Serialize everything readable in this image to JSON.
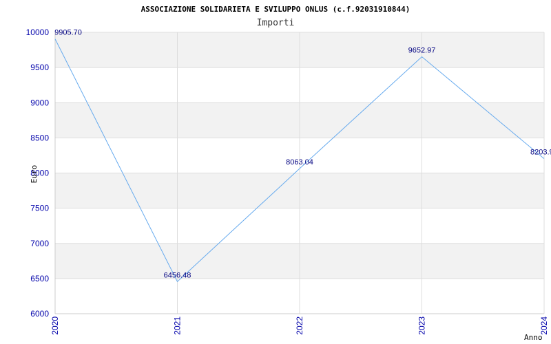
{
  "chart_data": {
    "type": "line",
    "title": "ASSOCIAZIONE SOLIDARIETA E SVILUPPO ONLUS (c.f.92031910844)",
    "subtitle": "Importi",
    "xlabel": "Anno",
    "ylabel": "Euro",
    "categories": [
      "2020",
      "2021",
      "2022",
      "2023",
      "2024"
    ],
    "series": [
      {
        "values": [
          9905.7,
          6456.48,
          8063.04,
          9652.97,
          8203.9
        ]
      }
    ],
    "data_labels": [
      "9905.70",
      "6456.48",
      "8063.04",
      "9652.97",
      "8203.9"
    ],
    "ylim": [
      6000,
      10000
    ],
    "yticks": [
      "6000",
      "6500",
      "7000",
      "7500",
      "8000",
      "8500",
      "9000",
      "9500",
      "10000"
    ],
    "grid": true,
    "colors": {
      "line": "#66aaee",
      "band": "#f2f2f2",
      "grid": "#dddddd",
      "tick": "#0000aa",
      "label": "#000080"
    }
  }
}
